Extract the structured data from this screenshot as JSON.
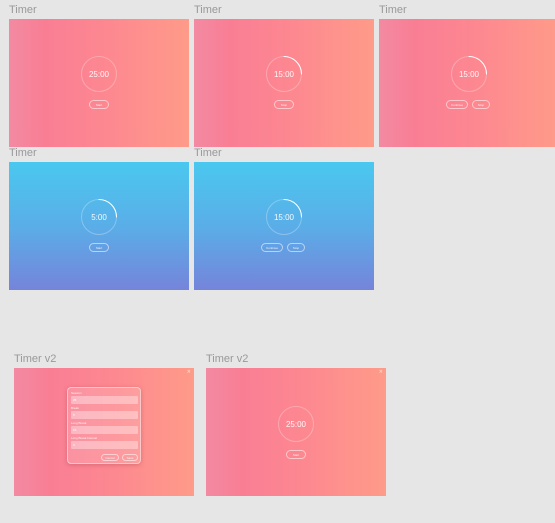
{
  "frames": [
    {
      "title": "Timer",
      "time": "25:00",
      "buttons": [
        "Start"
      ]
    },
    {
      "title": "Timer",
      "time": "15:00",
      "buttons": [
        "Stop"
      ]
    },
    {
      "title": "Timer",
      "time": "15:00",
      "buttons": [
        "Continue",
        "Stop"
      ]
    },
    {
      "title": "Timer",
      "time": "5:00",
      "buttons": [
        "Start"
      ]
    },
    {
      "title": "Timer",
      "time": "15:00",
      "buttons": [
        "Continue",
        "Stop"
      ]
    },
    {
      "title": "Timer v2",
      "close_glyph": "×",
      "settings": {
        "fields": [
          {
            "label": "Session",
            "value": "25"
          },
          {
            "label": "Break",
            "value": "5"
          },
          {
            "label": "Long Break",
            "value": "15"
          },
          {
            "label": "Long Break Interval",
            "value": "4"
          }
        ],
        "buttons": [
          "Cancel",
          "Save"
        ]
      }
    },
    {
      "title": "Timer v2",
      "close_glyph": "×",
      "time": "25:00",
      "buttons": [
        "Start"
      ]
    }
  ],
  "colors": {
    "canvas_bg": "#e6e6e6",
    "pink_gradient": [
      "#f28aa2",
      "#f97e94",
      "#fd8890",
      "#fe9b89"
    ],
    "blue_gradient": [
      "#4ac8ef",
      "#5aaee8",
      "#7584da"
    ],
    "title_text": "#999999"
  }
}
